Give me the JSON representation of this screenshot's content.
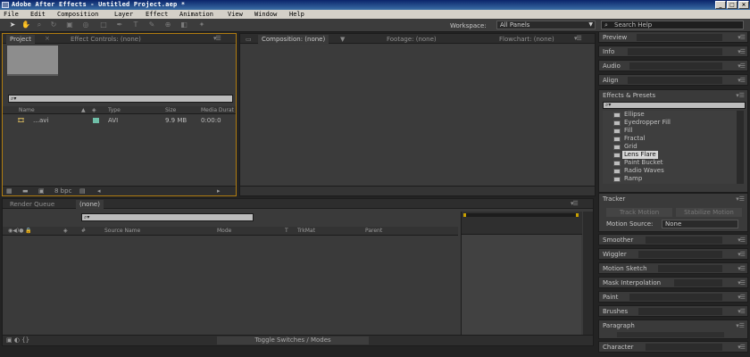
{
  "window": {
    "title": "Adobe After Effects - Untitled Project.aep *",
    "btn_min": "_",
    "btn_max": "□",
    "btn_close": "×"
  },
  "menu": [
    "File",
    "Edit",
    "Composition",
    "Layer",
    "Effect",
    "Animation",
    "View",
    "Window",
    "Help"
  ],
  "toolbar": {
    "workspace_label": "Workspace:",
    "workspace_value": "All Panels",
    "search_placeholder": "Search Help"
  },
  "project_panel": {
    "tab_project": "Project",
    "tab_effect_controls": "Effect Controls: (none)",
    "search_value": "",
    "columns": {
      "name": "Name",
      "type": "Type",
      "size": "Size",
      "media_duration": "Media Durat"
    },
    "rows": [
      {
        "name": "…avi",
        "type": "AVI",
        "size": "9.9 MB",
        "duration": "0:00:0"
      }
    ],
    "footer_bpc": "8 bpc"
  },
  "viewer": {
    "tab_composition": "Composition: (none)",
    "tab_footage": "Footage: (none)",
    "tab_flowchart": "Flowchart: (none)"
  },
  "timeline": {
    "tab_render_queue": "Render Queue",
    "tab_comp": "(none)",
    "columns": {
      "source_name": "Source Name",
      "mode": "Mode",
      "t": "T",
      "trkmat": "TrkMat",
      "parent": "Parent"
    },
    "toggle_label": "Toggle Switches / Modes"
  },
  "right_panels": {
    "preview": "Preview",
    "info": "Info",
    "audio": "Audio",
    "align": "Align",
    "effects_presets": "Effects & Presets",
    "effects_list": [
      "Ellipse",
      "Eyedropper Fill",
      "Fill",
      "Fractal",
      "Grid",
      "Lens Flare",
      "Paint Bucket",
      "Radio Waves",
      "Ramp"
    ],
    "selected_effect": "Lens Flare",
    "tracker": "Tracker",
    "track_motion": "Track Motion",
    "stabilize_motion": "Stabilize Motion",
    "motion_source_label": "Motion Source:",
    "motion_source_value": "None",
    "smoother": "Smoother",
    "wiggler": "Wiggler",
    "motion_sketch": "Motion Sketch",
    "mask_interpolation": "Mask Interpolation",
    "paint": "Paint",
    "brushes": "Brushes",
    "paragraph": "Paragraph",
    "character": "Character"
  }
}
